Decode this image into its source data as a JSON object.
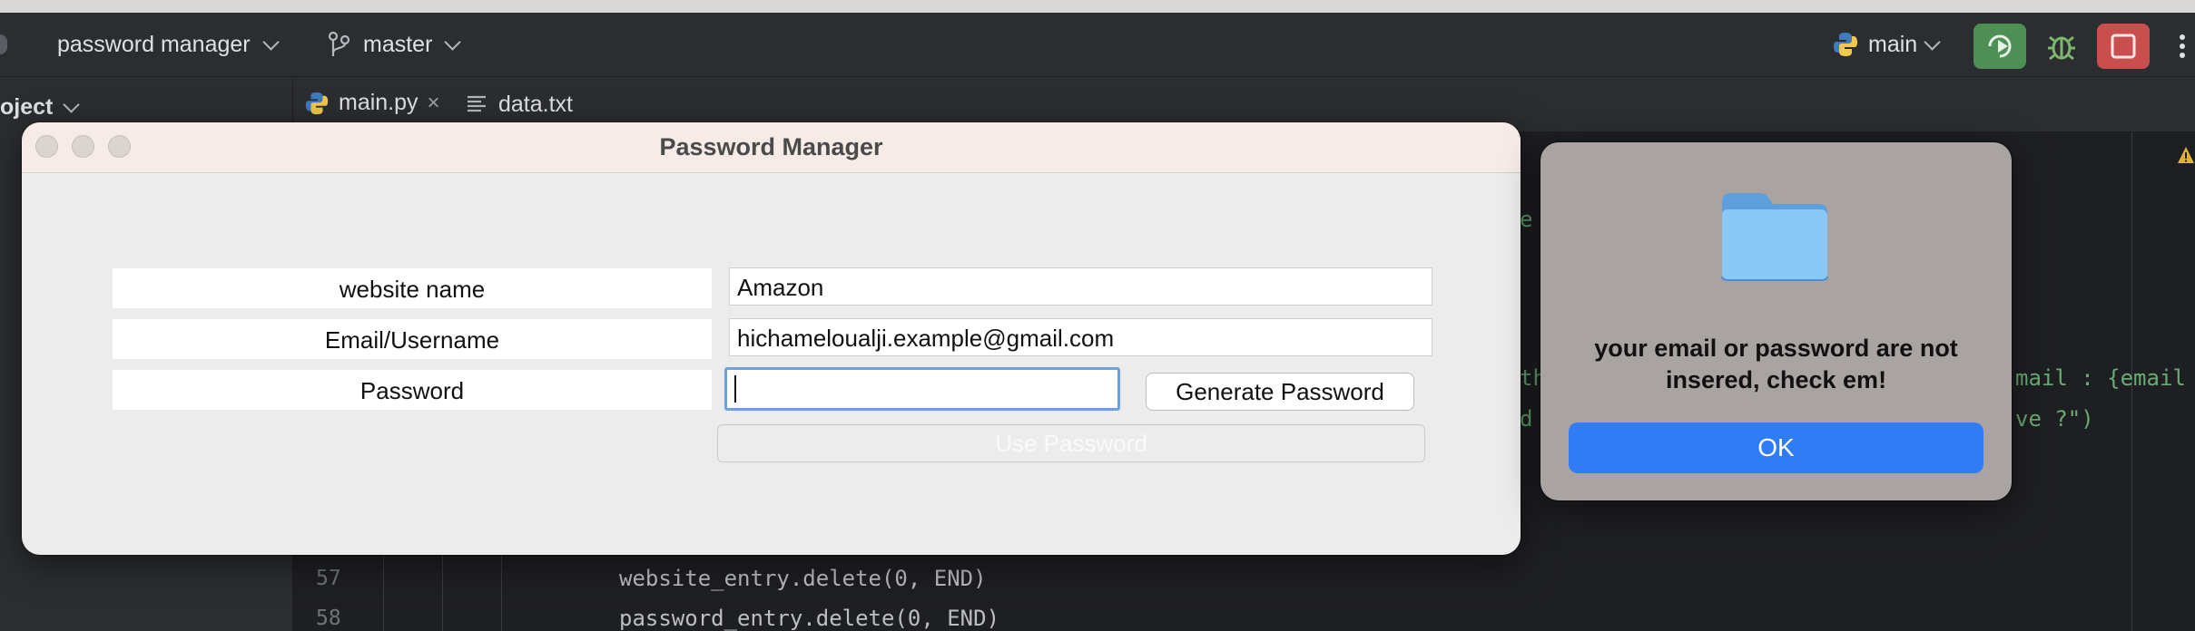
{
  "ide": {
    "project_selector": "password manager",
    "branch": "master",
    "run_config": "main",
    "project_panel_label": "oject",
    "tabs": [
      {
        "label": "main.py",
        "icon": "python-icon"
      },
      {
        "label": "data.txt",
        "icon": "text-file-icon"
      }
    ],
    "code_lines": [
      {
        "number": "57",
        "text": "website_entry.delete(0, END)"
      },
      {
        "number": "58",
        "text": "password_entry.delete(0, END)"
      }
    ],
    "code_fragments": {
      "frag_e": "e",
      "frag_th": "th",
      "frag_d": "d",
      "frag_mail": "mail : {email",
      "frag_ve": "ve ?\")"
    }
  },
  "password_manager": {
    "title": "Password Manager",
    "website_label": "website name",
    "email_label": "Email/Username",
    "password_label": "Password",
    "website_value": "Amazon",
    "email_value": "hichameloualji.example@gmail.com",
    "password_value": "",
    "generate_button": "Generate Password",
    "use_button": "Use Password"
  },
  "alert": {
    "icon": "folder-icon",
    "message": "your email or password are not insered, check em!",
    "ok_button": "OK"
  },
  "colors": {
    "accent": "#2f7cf6",
    "run_green": "#4e8f55",
    "stop_red": "#c94f4f"
  }
}
